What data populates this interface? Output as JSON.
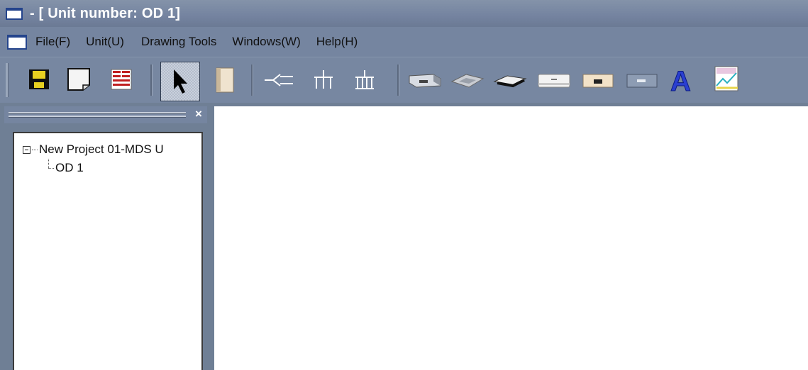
{
  "window": {
    "title": " - [ Unit number: OD 1]"
  },
  "menu": {
    "items": [
      "File(F)",
      "Unit(U)",
      "Drawing Tools",
      "Windows(W)",
      "Help(H)"
    ]
  },
  "toolbar": {
    "buttons": [
      {
        "name": "save-icon"
      },
      {
        "name": "new-document-icon"
      },
      {
        "name": "report-sheet-icon"
      },
      {
        "name": "select-pointer-icon"
      },
      {
        "name": "outdoor-unit-icon"
      },
      {
        "name": "pipe-branch-icon"
      },
      {
        "name": "header-branch-3-icon"
      },
      {
        "name": "header-branch-4-icon"
      },
      {
        "name": "duct-unit-icon"
      },
      {
        "name": "cassette-unit-icon"
      },
      {
        "name": "ceiling-unit-icon"
      },
      {
        "name": "wall-mounted-unit-icon"
      },
      {
        "name": "floor-unit-icon"
      },
      {
        "name": "console-unit-icon"
      },
      {
        "name": "text-tool-icon"
      },
      {
        "name": "picture-tool-icon"
      }
    ]
  },
  "tree": {
    "root_label": "New Project 01-MDS U",
    "child_label": "OD 1"
  },
  "panel": {
    "close_glyph": "×"
  },
  "colors": {
    "chrome": "#7585a0",
    "titlebar": "#7a89a4",
    "canvas": "#ffffff"
  }
}
